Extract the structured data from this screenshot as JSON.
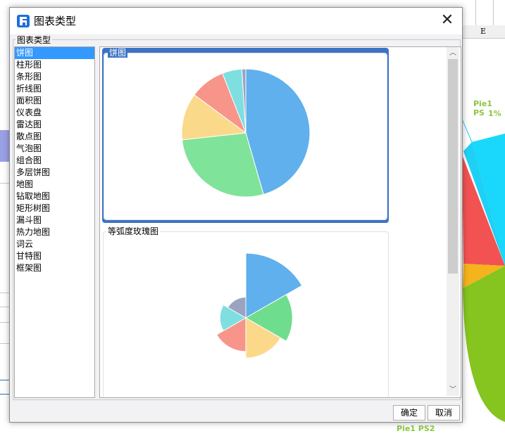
{
  "dialog": {
    "title": "图表类型",
    "close_glyph": "✕",
    "icon": "app-logo-icon",
    "group_label": "图表类型",
    "ok_label": "确定",
    "cancel_label": "取消"
  },
  "chart_types": [
    "饼图",
    "柱形图",
    "条形图",
    "折线图",
    "面积图",
    "仪表盘",
    "雷达图",
    "散点图",
    "气泡图",
    "组合图",
    "多层饼图",
    "地图",
    "钻取地图",
    "矩形树图",
    "漏斗图",
    "热力地图",
    "词云",
    "甘特图",
    "框架图"
  ],
  "selected_type": "饼图",
  "previews": {
    "pie_caption": "饼图",
    "rose_caption": "等弧度玫瑰图"
  },
  "background": {
    "column_header": "E",
    "label_top": "Pie1 PS",
    "label_pct": "1%",
    "label_bottom": "Pie1 PS2"
  },
  "chart_data": [
    {
      "type": "pie",
      "title": "",
      "values": [
        46,
        28,
        12,
        9,
        5,
        1
      ],
      "colors": [
        "#5fb0ec",
        "#7fe39a",
        "#fbd98a",
        "#f7958a",
        "#7fdfe0",
        "#9aa3c0"
      ]
    },
    {
      "type": "pie",
      "title": "",
      "variant": "rose",
      "values": [
        100,
        72,
        62,
        52,
        40,
        32
      ],
      "colors": [
        "#5fb0ec",
        "#6fdd8e",
        "#fcd98a",
        "#f7958a",
        "#7fdfe0",
        "#9aa3c0"
      ]
    }
  ],
  "colors": {
    "accent": "#3c73c4",
    "list_selection": "#3399ff",
    "bg_label": "#8cc63e"
  }
}
